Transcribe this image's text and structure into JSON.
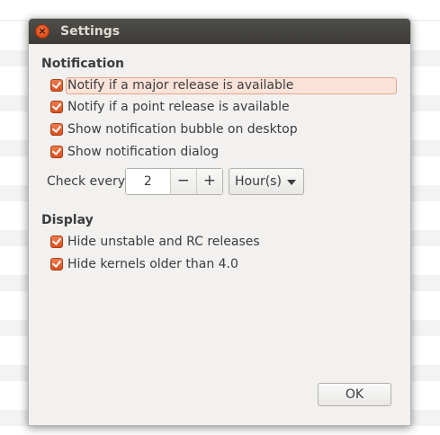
{
  "window": {
    "title": "Settings",
    "close_icon": "×"
  },
  "notification": {
    "header": "Notification",
    "options": [
      {
        "label": "Notify if a major release is available",
        "checked": true
      },
      {
        "label": "Notify if a point release is available",
        "checked": true
      },
      {
        "label": "Show notification bubble on desktop",
        "checked": true
      },
      {
        "label": "Show notification dialog",
        "checked": true
      }
    ],
    "check_every_label": "Check every",
    "interval_value": "2",
    "decrement_label": "−",
    "increment_label": "+",
    "unit_selected": "Hour(s)"
  },
  "display": {
    "header": "Display",
    "options": [
      {
        "label": "Hide unstable and RC releases",
        "checked": true
      },
      {
        "label": "Hide kernels older than 4.0",
        "checked": true
      }
    ]
  },
  "actions": {
    "ok_label": "OK"
  },
  "colors": {
    "accent": "#dd4814",
    "titlebar": "#3c3b37",
    "dialog_bg": "#f2f1f0"
  }
}
